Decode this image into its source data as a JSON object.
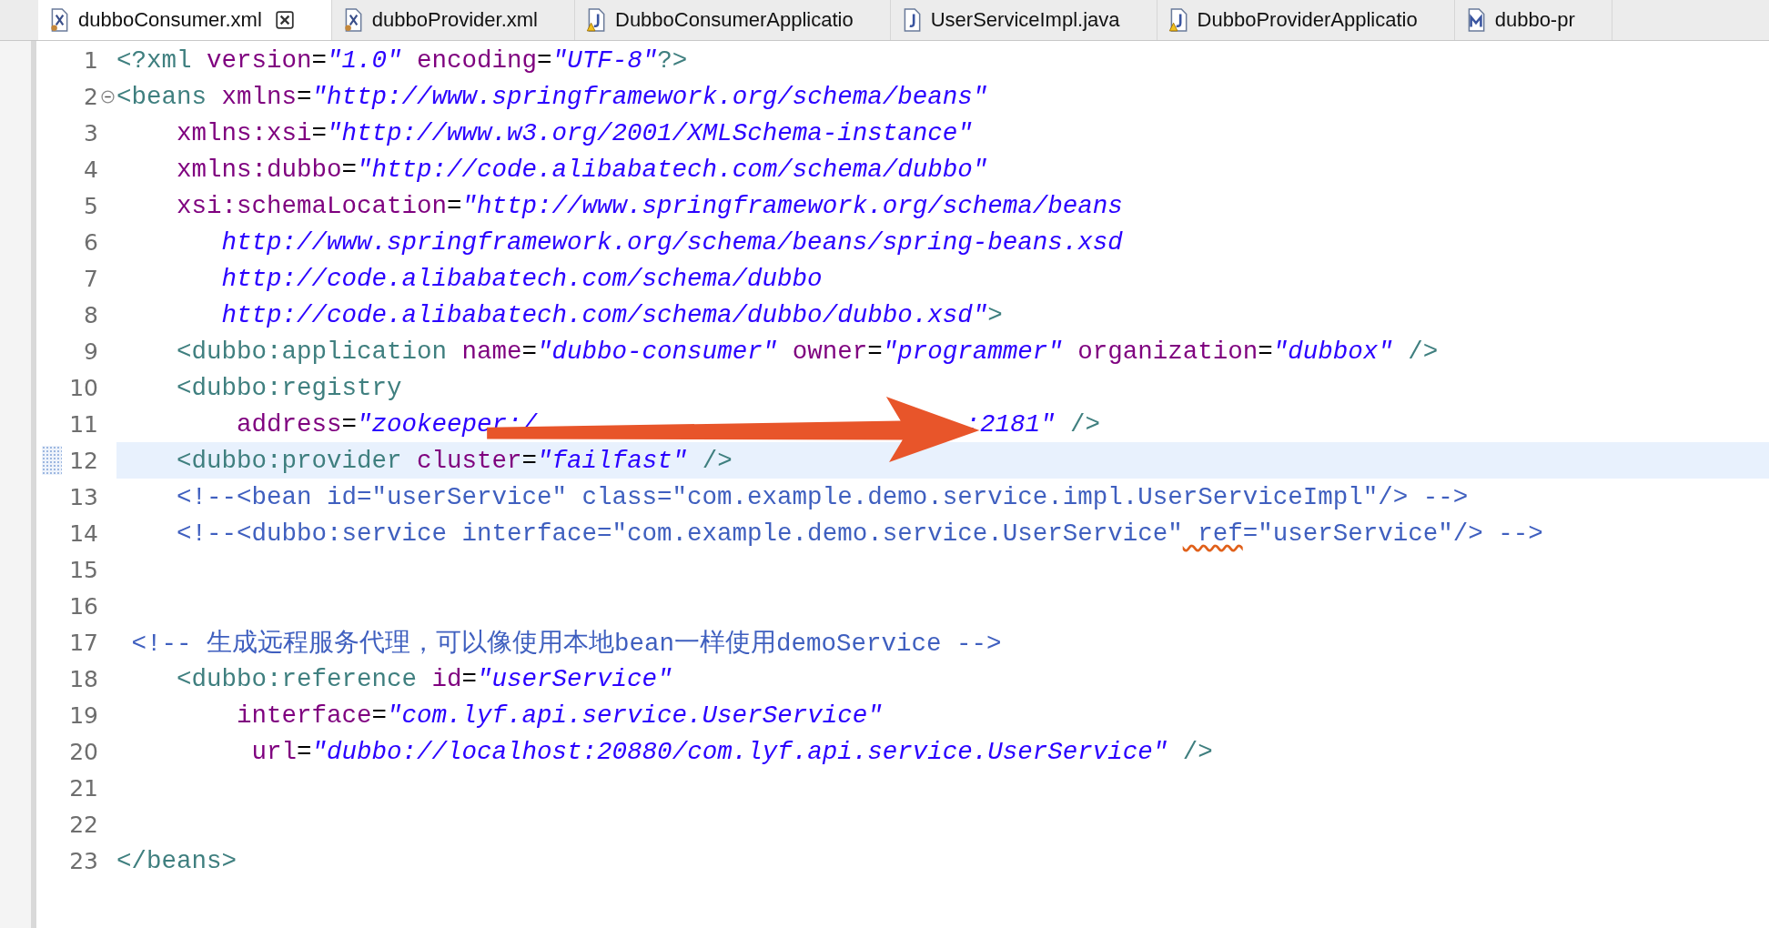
{
  "tabs": [
    {
      "label": "dubboConsumer.xml",
      "kind": "xml",
      "selected": true,
      "closable": true
    },
    {
      "label": "dubboProvider.xml",
      "kind": "xml",
      "selected": false,
      "closable": false
    },
    {
      "label": "DubboConsumerApplicatio",
      "kind": "java-warning",
      "selected": false,
      "closable": false
    },
    {
      "label": "UserServiceImpl.java",
      "kind": "java",
      "selected": false,
      "closable": false
    },
    {
      "label": "DubboProviderApplicatio",
      "kind": "java-warning",
      "selected": false,
      "closable": false
    },
    {
      "label": "dubbo-pr",
      "kind": "maven",
      "selected": false,
      "closable": false
    }
  ],
  "lines": [
    {
      "number": "1",
      "current": false,
      "foldable": false,
      "tokens": [
        {
          "kind": "tag",
          "text": "<?xml"
        },
        {
          "kind": "attr",
          "text": " version"
        },
        {
          "kind": "plain",
          "text": "="
        },
        {
          "kind": "str",
          "text": "\"1.0\""
        },
        {
          "kind": "attr",
          "text": " encoding"
        },
        {
          "kind": "plain",
          "text": "="
        },
        {
          "kind": "str",
          "text": "\"UTF-8\""
        },
        {
          "kind": "tag",
          "text": "?>"
        }
      ]
    },
    {
      "number": "2",
      "current": false,
      "foldable": true,
      "tokens": [
        {
          "kind": "tag",
          "text": "<beans"
        },
        {
          "kind": "attr",
          "text": " xmlns"
        },
        {
          "kind": "plain",
          "text": "="
        },
        {
          "kind": "str",
          "text": "\"http://www.springframework.org/schema/beans\""
        }
      ]
    },
    {
      "number": "3",
      "current": false,
      "foldable": false,
      "tokens": [
        {
          "kind": "attr",
          "text": "    xmlns:xsi"
        },
        {
          "kind": "plain",
          "text": "="
        },
        {
          "kind": "str",
          "text": "\"http://www.w3.org/2001/XMLSchema-instance\""
        }
      ]
    },
    {
      "number": "4",
      "current": false,
      "foldable": false,
      "tokens": [
        {
          "kind": "attr",
          "text": "    xmlns:dubbo"
        },
        {
          "kind": "plain",
          "text": "="
        },
        {
          "kind": "str",
          "text": "\"http://code.alibabatech.com/schema/dubbo\""
        }
      ]
    },
    {
      "number": "5",
      "current": false,
      "foldable": false,
      "tokens": [
        {
          "kind": "attr",
          "text": "    xsi:schemaLocation"
        },
        {
          "kind": "plain",
          "text": "="
        },
        {
          "kind": "str",
          "text": "\"http://www.springframework.org/schema/beans"
        }
      ]
    },
    {
      "number": "6",
      "current": false,
      "foldable": false,
      "tokens": [
        {
          "kind": "str",
          "text": "       http://www.springframework.org/schema/beans/spring-beans.xsd"
        }
      ]
    },
    {
      "number": "7",
      "current": false,
      "foldable": false,
      "tokens": [
        {
          "kind": "str",
          "text": "       http://code.alibabatech.com/schema/dubbo"
        }
      ]
    },
    {
      "number": "8",
      "current": false,
      "foldable": false,
      "tokens": [
        {
          "kind": "str",
          "text": "       http://code.alibabatech.com/schema/dubbo/dubbo.xsd\""
        },
        {
          "kind": "tag",
          "text": ">"
        }
      ]
    },
    {
      "number": "9",
      "current": false,
      "foldable": false,
      "tokens": [
        {
          "kind": "tag",
          "text": "    <dubbo:application"
        },
        {
          "kind": "attr",
          "text": " name"
        },
        {
          "kind": "plain",
          "text": "="
        },
        {
          "kind": "str",
          "text": "\"dubbo-consumer\""
        },
        {
          "kind": "attr",
          "text": " owner"
        },
        {
          "kind": "plain",
          "text": "="
        },
        {
          "kind": "str",
          "text": "\"programmer\""
        },
        {
          "kind": "attr",
          "text": " organization"
        },
        {
          "kind": "plain",
          "text": "="
        },
        {
          "kind": "str",
          "text": "\"dubbox\""
        },
        {
          "kind": "tag",
          "text": " />"
        }
      ]
    },
    {
      "number": "10",
      "current": false,
      "foldable": false,
      "tokens": [
        {
          "kind": "tag",
          "text": "    <dubbo:registry"
        }
      ]
    },
    {
      "number": "11",
      "current": false,
      "foldable": false,
      "tokens": [
        {
          "kind": "attr",
          "text": "        address"
        },
        {
          "kind": "plain",
          "text": "="
        },
        {
          "kind": "str",
          "text": "\"zookeeper:/"
        },
        {
          "kind": "gap"
        },
        {
          "kind": "str",
          "text": ":2181\""
        },
        {
          "kind": "tag",
          "text": " />"
        }
      ]
    },
    {
      "number": "12",
      "current": true,
      "foldable": false,
      "tokens": [
        {
          "kind": "tag",
          "text": "    <dubbo:provider"
        },
        {
          "kind": "attr",
          "text": " cluster"
        },
        {
          "kind": "plain",
          "text": "="
        },
        {
          "kind": "str",
          "text": "\"failfast\""
        },
        {
          "kind": "tag",
          "text": " />"
        }
      ]
    },
    {
      "number": "13",
      "current": false,
      "foldable": false,
      "tokens": [
        {
          "kind": "comment",
          "text": "    <!--<bean id=\"userService\" class=\"com.example.demo.service.impl.UserServiceImpl\"/> -->"
        }
      ]
    },
    {
      "number": "14",
      "current": false,
      "foldable": false,
      "tokens": [
        {
          "kind": "comment",
          "text": "    <!--<dubbo:service interface=\"com.example.demo.service.UserService\""
        },
        {
          "kind": "warn",
          "text": " ref"
        },
        {
          "kind": "comment",
          "text": "=\"userService\"/> -->"
        }
      ]
    },
    {
      "number": "15",
      "current": false,
      "foldable": false
    },
    {
      "number": "16",
      "current": false,
      "foldable": false
    },
    {
      "number": "17",
      "current": false,
      "foldable": false,
      "tokens": [
        {
          "kind": "comment",
          "text": " <!-- 生成远程服务代理，可以像使用本地bean一样使用demoService -->"
        }
      ]
    },
    {
      "number": "18",
      "current": false,
      "foldable": false,
      "tokens": [
        {
          "kind": "tag",
          "text": "    <dubbo:reference"
        },
        {
          "kind": "attr",
          "text": " id"
        },
        {
          "kind": "plain",
          "text": "="
        },
        {
          "kind": "str",
          "text": "\"userService\""
        }
      ]
    },
    {
      "number": "19",
      "current": false,
      "foldable": false,
      "tokens": [
        {
          "kind": "attr",
          "text": "        interface"
        },
        {
          "kind": "plain",
          "text": "="
        },
        {
          "kind": "str",
          "text": "\"com.lyf.api.service.UserService\""
        }
      ]
    },
    {
      "number": "20",
      "current": false,
      "foldable": false,
      "tokens": [
        {
          "kind": "attr",
          "text": "         url"
        },
        {
          "kind": "plain",
          "text": "="
        },
        {
          "kind": "str",
          "text": "\"dubbo://localhost:20880/com.lyf.api.service.UserService\""
        },
        {
          "kind": "tag",
          "text": " />"
        }
      ]
    },
    {
      "number": "21",
      "current": false,
      "foldable": false
    },
    {
      "number": "22",
      "current": false,
      "foldable": false
    },
    {
      "number": "23",
      "current": false,
      "foldable": false,
      "tokens": [
        {
          "kind": "tag",
          "text": "</beans>"
        }
      ]
    }
  ]
}
